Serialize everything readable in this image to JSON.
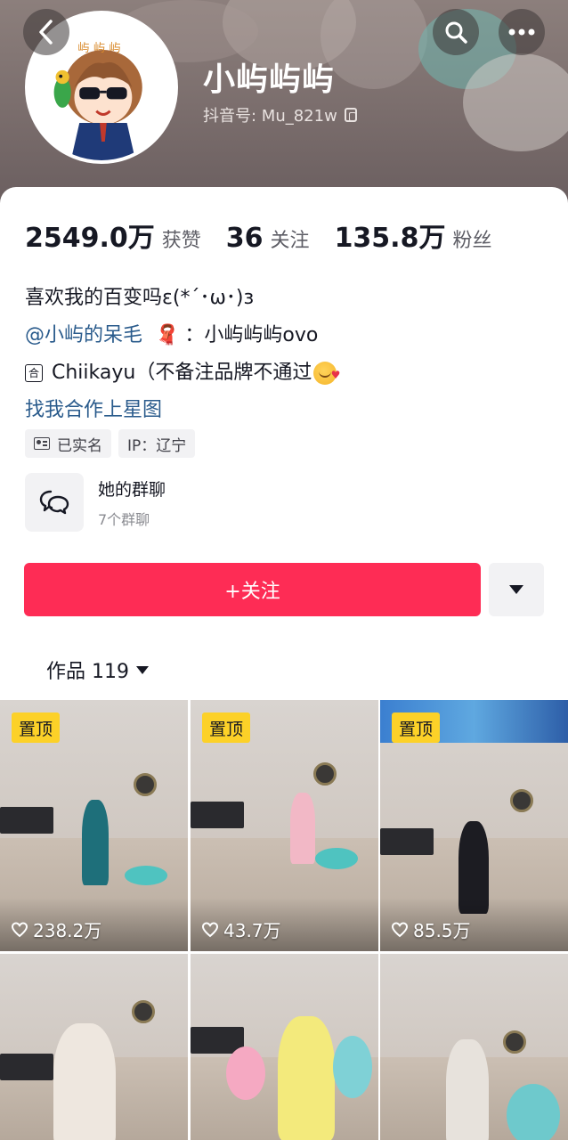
{
  "header": {
    "nickname": "小屿屿屿",
    "douyin_id_label": "抖音号: Mu_821w",
    "icons": [
      "back-icon",
      "search-icon",
      "more-icon",
      "copy-icon"
    ]
  },
  "stats": [
    {
      "num": "2549.0万",
      "label": "获赞"
    },
    {
      "num": "36",
      "label": "关注"
    },
    {
      "num": "135.8万",
      "label": "粉丝"
    }
  ],
  "bio": {
    "line1": "喜欢我的百变吗ε(*´･ω･)з",
    "mention": "@小屿的呆毛",
    "scarf_glyph": "🧣",
    "line2_rest": "：小屿屿屿ovo",
    "line3_icon": "合",
    "line3": "Chiikayu（不备注品牌不通过",
    "link": "找我合作上星图"
  },
  "tags": [
    {
      "label": "已实名",
      "icon": "id-card-icon"
    },
    {
      "label": "IP：辽宁"
    }
  ],
  "group_chat": {
    "title": "她的群聊",
    "subtitle": "7个群聊",
    "icon": "chat-bubbles-icon"
  },
  "actions": {
    "follow_label": "+关注",
    "accent_color": "#fe2c55"
  },
  "works_tab": {
    "label": "作品 119"
  },
  "videos": [
    {
      "pinned_label": "置顶",
      "likes": "238.2万"
    },
    {
      "pinned_label": "置顶",
      "likes": "43.7万"
    },
    {
      "pinned_label": "置顶",
      "likes": "85.5万"
    },
    {
      "pinned_label": "",
      "likes": ""
    },
    {
      "pinned_label": "",
      "likes": ""
    },
    {
      "pinned_label": "",
      "likes": ""
    }
  ],
  "colors": {
    "pin_badge": "#fcd128",
    "link": "#2a5b8c"
  }
}
